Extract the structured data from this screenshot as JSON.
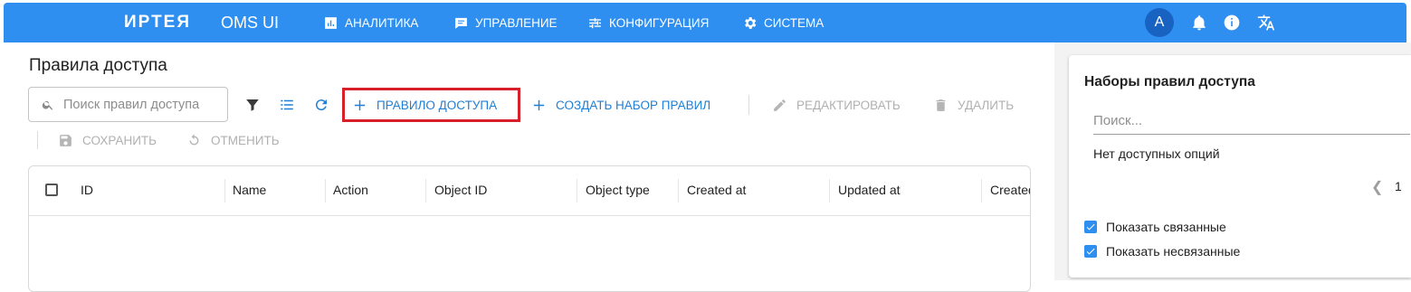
{
  "header": {
    "logo": "ИРТЕЯ",
    "app_name": "OMS UI",
    "nav": [
      {
        "label": "АНАЛИТИКА",
        "icon": "analytics-icon"
      },
      {
        "label": "УПРАВЛЕНИЕ",
        "icon": "management-icon"
      },
      {
        "label": "КОНФИГУРАЦИЯ",
        "icon": "configuration-icon"
      },
      {
        "label": "СИСТЕМА",
        "icon": "gear-icon"
      }
    ],
    "avatar_letter": "A"
  },
  "page": {
    "title": "Правила доступа"
  },
  "search": {
    "placeholder": "Поиск правил доступа"
  },
  "toolbar": {
    "add_rule": "ПРАВИЛО ДОСТУПА",
    "create_set": "СОЗДАТЬ НАБОР ПРАВИЛ",
    "edit": "РЕДАКТИРОВАТЬ",
    "delete": "УДАЛИТЬ",
    "save": "СОХРАНИТЬ",
    "cancel": "ОТМЕНИТЬ"
  },
  "table": {
    "columns": [
      "ID",
      "Name",
      "Action",
      "Object ID",
      "Object type",
      "Created at",
      "Updated at",
      "Created by"
    ]
  },
  "rule_sets": {
    "title": "Наборы правил доступа",
    "search_placeholder": "Поиск...",
    "empty_text": "Нет доступных опций",
    "page_number": "1",
    "show_linked": "Показать связанные",
    "show_unlinked": "Показать несвязанные"
  },
  "colors": {
    "header_bg": "#2f8ff0",
    "accent": "#1f7fd6",
    "highlight_border": "#d6202a",
    "avatar_bg": "#1863c2"
  }
}
